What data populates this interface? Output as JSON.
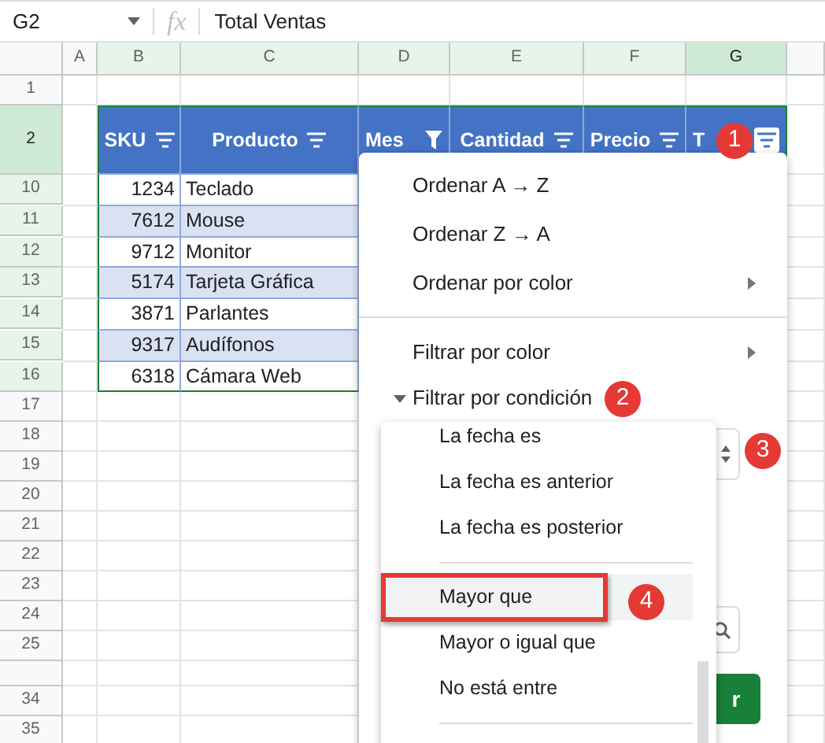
{
  "formula_bar": {
    "cell_ref": "G2",
    "fx": "fx",
    "value": "Total Ventas"
  },
  "column_headers": [
    {
      "label": "A",
      "in_range": false,
      "active": false
    },
    {
      "label": "B",
      "in_range": true,
      "active": false
    },
    {
      "label": "C",
      "in_range": true,
      "active": false
    },
    {
      "label": "D",
      "in_range": true,
      "active": false
    },
    {
      "label": "E",
      "in_range": true,
      "active": false
    },
    {
      "label": "F",
      "in_range": true,
      "active": false
    },
    {
      "label": "G",
      "in_range": true,
      "active": true
    }
  ],
  "table": {
    "columns": [
      {
        "label": "SKU",
        "filter_applied": false,
        "menu_open": false
      },
      {
        "label": "Producto",
        "filter_applied": false,
        "menu_open": false
      },
      {
        "label": "Mes",
        "filter_applied": true,
        "menu_open": false
      },
      {
        "label": "Cantidad",
        "filter_applied": false,
        "menu_open": false
      },
      {
        "label": "Precio",
        "filter_applied": false,
        "menu_open": false
      },
      {
        "label": "T",
        "filter_applied": false,
        "menu_open": true
      }
    ]
  },
  "rows": [
    {
      "kind": "empty",
      "number": "1",
      "in_range": false,
      "active": false
    },
    {
      "kind": "header_row",
      "number": "2",
      "in_range": true,
      "active": true
    },
    {
      "kind": "data_row",
      "number": "10",
      "in_range": true,
      "active": false,
      "cells": [
        "1234",
        "Teclado"
      ]
    },
    {
      "kind": "data_row",
      "number": "11",
      "in_range": true,
      "active": false,
      "cells": [
        "7612",
        "Mouse"
      ]
    },
    {
      "kind": "data_row",
      "number": "12",
      "in_range": true,
      "active": false,
      "cells": [
        "9712",
        "Monitor"
      ]
    },
    {
      "kind": "data_row",
      "number": "13",
      "in_range": true,
      "active": false,
      "cells": [
        "5174",
        "Tarjeta Gráfica"
      ]
    },
    {
      "kind": "data_row",
      "number": "14",
      "in_range": true,
      "active": false,
      "cells": [
        "3871",
        "Parlantes"
      ]
    },
    {
      "kind": "data_row",
      "number": "15",
      "in_range": true,
      "active": false,
      "cells": [
        "9317",
        "Audífonos"
      ]
    },
    {
      "kind": "data_row",
      "number": "16",
      "in_range": true,
      "active": false,
      "cells": [
        "6318",
        "Cámara Web"
      ]
    },
    {
      "kind": "empty",
      "number": "17",
      "in_range": false,
      "active": false
    },
    {
      "kind": "empty",
      "number": "18",
      "in_range": false,
      "active": false
    },
    {
      "kind": "empty",
      "number": "19",
      "in_range": false,
      "active": false
    },
    {
      "kind": "empty",
      "number": "20",
      "in_range": false,
      "active": false
    },
    {
      "kind": "empty",
      "number": "21",
      "in_range": false,
      "active": false
    },
    {
      "kind": "empty",
      "number": "22",
      "in_range": false,
      "active": false
    },
    {
      "kind": "empty",
      "number": "23",
      "in_range": false,
      "active": false
    },
    {
      "kind": "empty",
      "number": "24",
      "in_range": false,
      "active": false
    },
    {
      "kind": "empty",
      "number": "25",
      "in_range": false,
      "active": false
    },
    {
      "kind": "sliver"
    },
    {
      "kind": "empty",
      "number": "34",
      "in_range": false,
      "active": false
    },
    {
      "kind": "empty",
      "number": "35",
      "in_range": false,
      "active": false
    }
  ],
  "filter_menu": {
    "items": [
      {
        "kind": "action",
        "label": "Ordenar A → Z"
      },
      {
        "kind": "action",
        "label": "Ordenar Z → A"
      },
      {
        "kind": "submenu",
        "label": "Ordenar por color"
      },
      {
        "kind": "divider"
      },
      {
        "kind": "submenu",
        "label": "Filtrar por color"
      },
      {
        "kind": "section",
        "label": "Filtrar por condición",
        "expanded": true
      }
    ],
    "apply_button": {
      "label": "r"
    }
  },
  "condition_dropdown": {
    "options": [
      {
        "kind": "option",
        "label": "La fecha es",
        "selected": false,
        "framed": false
      },
      {
        "kind": "option",
        "label": "La fecha es anterior",
        "selected": false,
        "framed": false
      },
      {
        "kind": "option",
        "label": "La fecha es posterior",
        "selected": false,
        "framed": false
      },
      {
        "kind": "divider"
      },
      {
        "kind": "option",
        "label": "Mayor que",
        "selected": true,
        "framed": true
      },
      {
        "kind": "option",
        "label": "Mayor o igual que",
        "selected": false,
        "framed": false
      },
      {
        "kind": "option",
        "label": "No está entre",
        "selected": false,
        "framed": false
      },
      {
        "kind": "divider"
      }
    ]
  },
  "callouts": [
    {
      "label": "1"
    },
    {
      "label": "2"
    },
    {
      "label": "3"
    },
    {
      "label": "4"
    }
  ]
}
